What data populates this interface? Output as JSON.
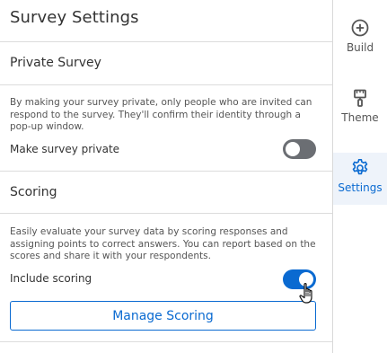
{
  "title": "Survey Settings",
  "private_survey": {
    "heading": "Private Survey",
    "description": "By making your survey private, only people who are invited can respond to the survey. They'll confirm their identity through a pop-up window.",
    "toggle_label": "Make survey private",
    "enabled": false
  },
  "scoring": {
    "heading": "Scoring",
    "description": "Easily evaluate your survey data by scoring responses and assigning points to correct answers. You can report based on the scores and share it with your respondents.",
    "toggle_label": "Include scoring",
    "enabled": true,
    "manage_button": "Manage Scoring"
  },
  "rail": {
    "items": [
      {
        "label": "Build",
        "icon": "plus-circle-icon",
        "active": false
      },
      {
        "label": "Theme",
        "icon": "paint-roller-icon",
        "active": false
      },
      {
        "label": "Settings",
        "icon": "gear-icon",
        "active": true
      }
    ]
  },
  "colors": {
    "accent": "#0a6ad1",
    "toggle_off": "#6b6e73",
    "active_rail_bg": "#eef3fa"
  }
}
